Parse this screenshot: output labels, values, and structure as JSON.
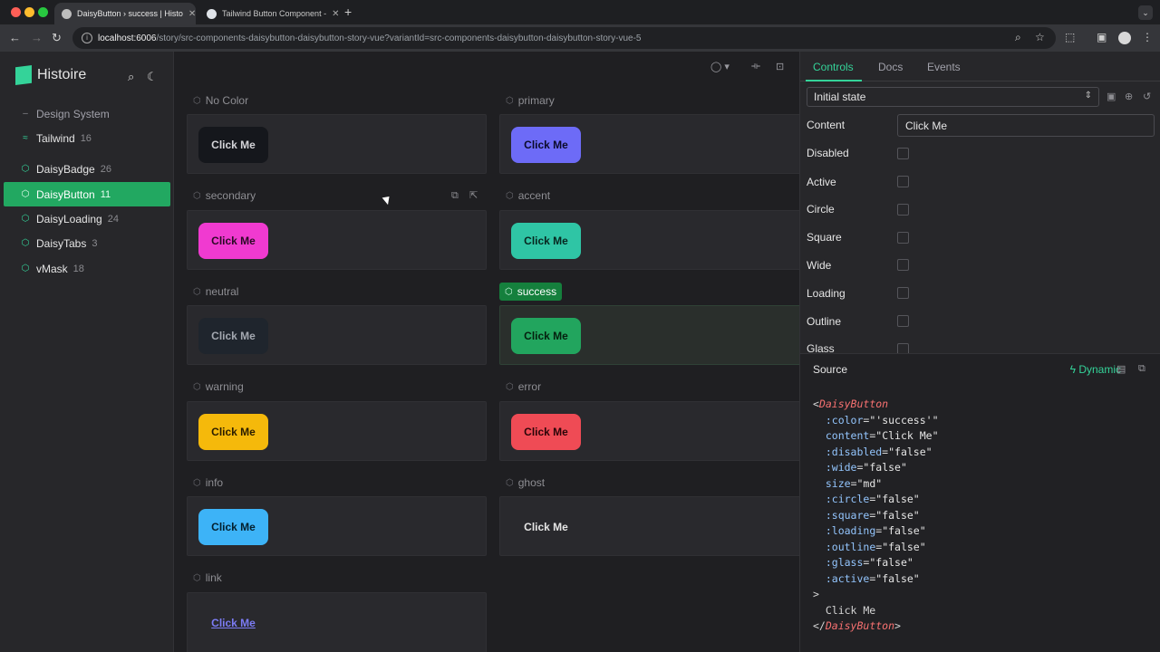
{
  "browser": {
    "tabs": [
      {
        "title": "DaisyButton › success | Histo",
        "close": "✕"
      },
      {
        "title": "Tailwind Button Component -",
        "close": "✕"
      }
    ],
    "new_tab": "+",
    "url_host": "localhost:6006",
    "url_path": "/story/src-components-daisybutton-daisybutton-story-vue?variantId=src-components-daisybutton-daisybutton-story-vue-5"
  },
  "sidebar": {
    "app_name": "Histoire",
    "items": [
      {
        "label": "Design System",
        "count": ""
      },
      {
        "label": "Tailwind",
        "count": "16"
      },
      {
        "label": "DaisyBadge",
        "count": "26"
      },
      {
        "label": "DaisyButton",
        "count": "11"
      },
      {
        "label": "DaisyLoading",
        "count": "24"
      },
      {
        "label": "DaisyTabs",
        "count": "3"
      },
      {
        "label": "vMask",
        "count": "18"
      }
    ]
  },
  "variants": [
    {
      "label": "No Color",
      "button": "Click Me",
      "bg": "#15171c",
      "fg": "#d4d4d8"
    },
    {
      "label": "primary",
      "button": "Click Me",
      "bg": "#6d6bf7",
      "fg": "#0b0b2a"
    },
    {
      "label": "secondary",
      "button": "Click Me",
      "bg": "#f03ad0",
      "fg": "#2a0a25"
    },
    {
      "label": "accent",
      "button": "Click Me",
      "bg": "#2fc5a5",
      "fg": "#07261f"
    },
    {
      "label": "neutral",
      "button": "Click Me",
      "bg": "#1f252d",
      "fg": "#a3a8b0"
    },
    {
      "label": "success",
      "button": "Click Me",
      "bg": "#22a55e",
      "fg": "#05200f"
    },
    {
      "label": "warning",
      "button": "Click Me",
      "bg": "#f5b90b",
      "fg": "#2a1d00"
    },
    {
      "label": "error",
      "button": "Click Me",
      "bg": "#ef4b55",
      "fg": "#2a0508"
    },
    {
      "label": "info",
      "button": "Click Me",
      "bg": "#3db3f7",
      "fg": "#04202e"
    },
    {
      "label": "ghost",
      "button": "Click Me",
      "bg": "transparent",
      "fg": "#e5e5e5"
    },
    {
      "label": "link",
      "button": "Click Me",
      "bg": "transparent",
      "fg": "#7c7cf5"
    }
  ],
  "panel": {
    "tabs": [
      "Controls",
      "Docs",
      "Events"
    ],
    "state": "Initial state",
    "controls": [
      "Content",
      "Disabled",
      "Active",
      "Circle",
      "Square",
      "Wide",
      "Loading",
      "Outline",
      "Glass"
    ],
    "content_value": "Click Me",
    "source_title": "Source",
    "dynamic_label": "Dynamic"
  },
  "source_code": {
    "open_tag": "DaisyButton",
    "attrs": [
      {
        "name": ":color",
        "value": "\"'success'\""
      },
      {
        "name": "content",
        "value": "\"Click Me\""
      },
      {
        "name": ":disabled",
        "value": "\"false\""
      },
      {
        "name": ":wide",
        "value": "\"false\""
      },
      {
        "name": "size",
        "value": "\"md\""
      },
      {
        "name": ":circle",
        "value": "\"false\""
      },
      {
        "name": ":square",
        "value": "\"false\""
      },
      {
        "name": ":loading",
        "value": "\"false\""
      },
      {
        "name": ":outline",
        "value": "\"false\""
      },
      {
        "name": ":glass",
        "value": "\"false\""
      },
      {
        "name": ":active",
        "value": "\"false\""
      }
    ],
    "body": "Click Me"
  }
}
